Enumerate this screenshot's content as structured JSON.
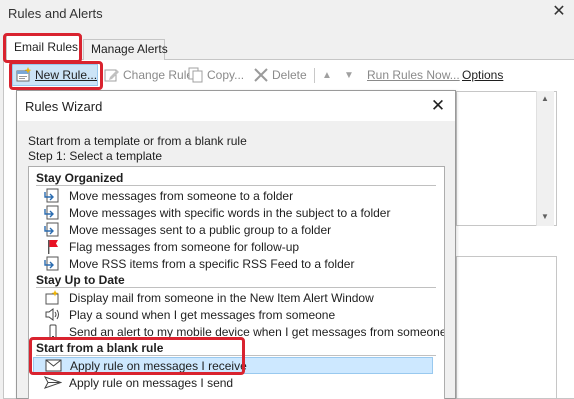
{
  "window": {
    "title": "Rules and Alerts"
  },
  "tabs": [
    {
      "label": "Email Rules",
      "active": true
    },
    {
      "label": "Manage Alerts",
      "active": false
    }
  ],
  "toolbar": {
    "new_rule": "New Rule...",
    "change_rule": "Change Rule",
    "copy": "Copy...",
    "delete": "Delete",
    "run_rules_now": "Run Rules Now...",
    "options": "Options"
  },
  "wizard": {
    "title": "Rules Wizard",
    "intro": "Start from a template or from a blank rule",
    "step": "Step 1: Select a template",
    "groups": [
      {
        "name": "Stay Organized",
        "items": [
          {
            "label": "Move messages from someone to a folder",
            "icon": "move-to-folder-icon"
          },
          {
            "label": "Move messages with specific words in the subject to a folder",
            "icon": "move-to-folder-icon"
          },
          {
            "label": "Move messages sent to a public group to a folder",
            "icon": "move-to-folder-icon"
          },
          {
            "label": "Flag messages from someone for follow-up",
            "icon": "flag-icon"
          },
          {
            "label": "Move RSS items from a specific RSS Feed to a folder",
            "icon": "move-to-folder-icon"
          }
        ]
      },
      {
        "name": "Stay Up to Date",
        "items": [
          {
            "label": "Display mail from someone in the New Item Alert Window",
            "icon": "alert-window-icon"
          },
          {
            "label": "Play a sound when I get messages from someone",
            "icon": "speaker-icon"
          },
          {
            "label": "Send an alert to my mobile device when I get messages from someone",
            "icon": "mobile-device-icon"
          }
        ]
      },
      {
        "name": "Start from a blank rule",
        "items": [
          {
            "label": "Apply rule on messages I receive",
            "icon": "envelope-icon",
            "selected": true
          },
          {
            "label": "Apply rule on messages I send",
            "icon": "send-arrow-icon"
          }
        ]
      }
    ]
  },
  "colors": {
    "highlight": "#d9232f",
    "selection": "#cde8ff",
    "flag": "#e81123"
  }
}
